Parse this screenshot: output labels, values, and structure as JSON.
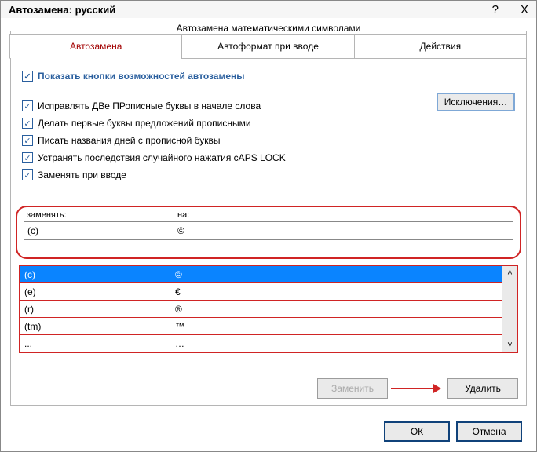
{
  "window": {
    "title": "Автозамена: русский",
    "help_glyph": "?",
    "close_glyph": "X"
  },
  "fieldset_legend": "Автозамена математическими символами",
  "tabs": {
    "t0": "Автозамена",
    "t1": "Автоформат при вводе",
    "t2": "Действия"
  },
  "checks": {
    "c_top": "Показать кнопки возможностей автозамены",
    "c1": "Исправлять ДВе ПРописные буквы в начале слова",
    "c2": "Делать первые буквы предложений прописными",
    "c3": "Писать названия дней с прописной буквы",
    "c4": "Устранять последствия случайного нажатия cAPS LOCK",
    "c5": "Заменять при вводе"
  },
  "exceptions_label": "Исключения…",
  "columns": {
    "replace": "заменять:",
    "with": "на:"
  },
  "inputs": {
    "replace_val": "(c)",
    "with_val": "©"
  },
  "rows": [
    {
      "a": "(c)",
      "b": "©"
    },
    {
      "a": "(e)",
      "b": "€"
    },
    {
      "a": "(r)",
      "b": "®"
    },
    {
      "a": "(tm)",
      "b": "™"
    },
    {
      "a": "...",
      "b": "…"
    }
  ],
  "inner_buttons": {
    "replace": "Заменить",
    "delete": "Удалить"
  },
  "bottom_buttons": {
    "ok": "ОК",
    "cancel": "Отмена"
  }
}
